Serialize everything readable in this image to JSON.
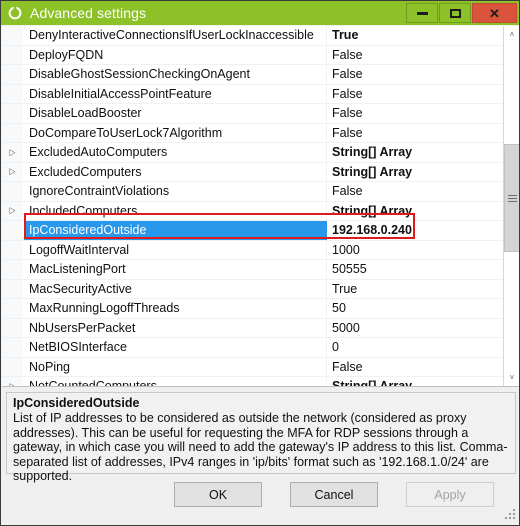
{
  "window": {
    "title": "Advanced settings",
    "icon": "app-ring-icon",
    "titlebar_color": "#8CC127",
    "close_color": "#D9543B",
    "controls": {
      "minimize": "minimize-icon",
      "maximize": "maximize-icon",
      "close": "✕"
    }
  },
  "grid": {
    "selection_color": "#2a98ea",
    "annotation_color": "#e01b1b",
    "rows": [
      {
        "name": "DenyInteractiveConnectionsIfUserLockInaccessible",
        "value": "True",
        "bold": true,
        "expandable": false,
        "selected": false
      },
      {
        "name": "DeployFQDN",
        "value": "False",
        "bold": false,
        "expandable": false,
        "selected": false
      },
      {
        "name": "DisableGhostSessionCheckingOnAgent",
        "value": "False",
        "bold": false,
        "expandable": false,
        "selected": false
      },
      {
        "name": "DisableInitialAccessPointFeature",
        "value": "False",
        "bold": false,
        "expandable": false,
        "selected": false
      },
      {
        "name": "DisableLoadBooster",
        "value": "False",
        "bold": false,
        "expandable": false,
        "selected": false
      },
      {
        "name": "DoCompareToUserLock7Algorithm",
        "value": "False",
        "bold": false,
        "expandable": false,
        "selected": false
      },
      {
        "name": "ExcludedAutoComputers",
        "value": "String[] Array",
        "bold": true,
        "expandable": true,
        "selected": false
      },
      {
        "name": "ExcludedComputers",
        "value": "String[] Array",
        "bold": true,
        "expandable": true,
        "selected": false
      },
      {
        "name": "IgnoreContraintViolations",
        "value": "False",
        "bold": false,
        "expandable": false,
        "selected": false
      },
      {
        "name": "IncludedComputers",
        "value": "String[] Array",
        "bold": true,
        "expandable": true,
        "selected": false
      },
      {
        "name": "IpConsideredOutside",
        "value": "192.168.0.240",
        "bold": true,
        "expandable": false,
        "selected": true
      },
      {
        "name": "LogoffWaitInterval",
        "value": "1000",
        "bold": false,
        "expandable": false,
        "selected": false
      },
      {
        "name": "MacListeningPort",
        "value": "50555",
        "bold": false,
        "expandable": false,
        "selected": false
      },
      {
        "name": "MacSecurityActive",
        "value": "True",
        "bold": false,
        "expandable": false,
        "selected": false
      },
      {
        "name": "MaxRunningLogoffThreads",
        "value": "50",
        "bold": false,
        "expandable": false,
        "selected": false
      },
      {
        "name": "NbUsersPerPacket",
        "value": "5000",
        "bold": false,
        "expandable": false,
        "selected": false
      },
      {
        "name": "NetBIOSInterface",
        "value": "0",
        "bold": false,
        "expandable": false,
        "selected": false
      },
      {
        "name": "NoPing",
        "value": "False",
        "bold": false,
        "expandable": false,
        "selected": false
      },
      {
        "name": "NotCountedComputers",
        "value": "String[] Array",
        "bold": true,
        "expandable": true,
        "selected": false
      }
    ]
  },
  "scrollbar": {
    "up_arrow": "˄",
    "down_arrow": "˅"
  },
  "description": {
    "title": "IpConsideredOutside",
    "body": "List of IP addresses to be considered as outside the network (considered as proxy addresses). This can be useful for requesting the MFA for RDP sessions through a gateway, in which case you will need to add the gateway's IP address to this list. Comma-separated list of addresses, IPv4 ranges in 'ip/bits' format such as '192.168.1.0/24' are supported."
  },
  "buttons": {
    "ok": "OK",
    "cancel": "Cancel",
    "apply": "Apply",
    "apply_disabled": true
  }
}
